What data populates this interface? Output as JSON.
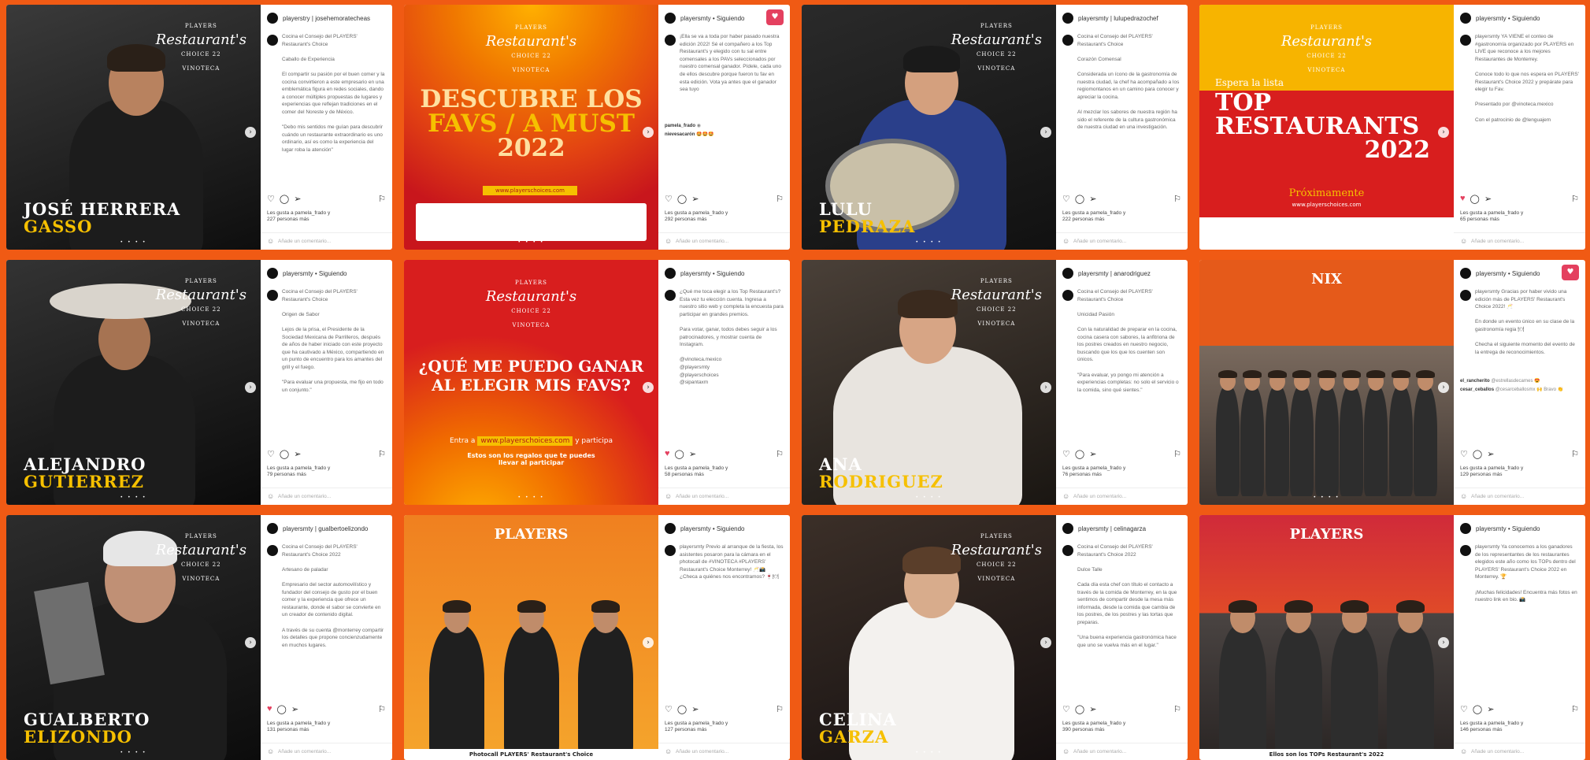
{
  "posts": [
    {
      "handle": "playerstry | josehemoratecheas",
      "author": "playersmty",
      "caption": "Cocina el Consejo del PLAYERS' Restaurant's Choice\n\nCaballo de Experiencia\n\nEl compartir su pasión por el buen comer y la cocina convirtieron a este empresario en una emblemática figura en redes sociales, dando a conocer múltiples propuestas de lugares y experiencias que reflejan tradiciones en el comer del Noreste y de México.\n\n\"Debo mis sentidos me guían para descubrir cuándo un restaurante extraordinario es uno ordinario, así es como la experiencia del lugar roba la atención\"",
      "comments": [],
      "likes_line1": "Les gusta a pamela_frado y",
      "likes_line2": "227 personas más",
      "add_comment": "Añade un comentario...",
      "name_line1": "JOSÉ HERRERA",
      "name_line2": "GASSO"
    },
    {
      "handle": "playersmty • Siguiendo",
      "author": "playersmty",
      "caption": "¡Ella se va a toda por haber pasado nuestra edición 2022! Sé el compañero a los Top Restaurant's y elegido con tu sal entre comensales a los PAVs seleccionados por nuestro comensal ganador. Pídele, cada uno de ellos descubre porque fueron tu fav en esta edición. Vota ya antes que el ganador sea tuyo",
      "comments": [
        {
          "user": "pamela_frado",
          "text": "◉"
        },
        {
          "user": "nievesacarón",
          "text": "🤩🤩🤩"
        }
      ],
      "likes_line1": "Les gusta a pamela_frado y",
      "likes_line2": "292 personas más",
      "add_comment": "Añade un comentario...",
      "title_line1": "DESCUBRE LOS",
      "title_line2": "FAVS / A MUST",
      "title_line3": "2022",
      "url": "www.playerschoices.com"
    },
    {
      "handle": "playersmty | lulupedrazochef",
      "author": "playersmty",
      "caption": "Cocina el Consejo del PLAYERS' Restaurant's Choice\n\nCorazón Comensal\n\nConsiderada un ícono de la gastronomía de nuestra ciudad, la chef ha acompañado a los regiomontanos en un camino para conocer y apreciar la cocina.\n\nAl mezclar los sabores de nuestra región ha sido el referente de la cultura gastronómica de nuestra ciudad en una investigación.",
      "comments": [],
      "likes_line1": "Les gusta a pamela_frado y",
      "likes_line2": "222 personas más",
      "add_comment": "Añade un comentario...",
      "name_line1": "LULU",
      "name_line2": "PEDRAZA"
    },
    {
      "handle": "playersmty • Siguiendo",
      "author": "playersmty",
      "caption": "playersmty YA VIENE el conteo de #gastronomía organizado por PLAYERS en LIVE que reconoce a los mejores Restaurantes de Monterrey.\n\nConoce todo lo que nos espera en PLAYERS' Restaurant's Choice 2022 y prepárate para elegir tu Fav.\n\nPresentado por @vinoteca.mexico\n\nCon el patrocinio de @lenguajem",
      "comments": [],
      "likes_line1": "Les gusta a pamela_frado y",
      "likes_line2": "65 personas más",
      "add_comment": "Añade un comentario...",
      "subtitle": "Espera la lista",
      "title_line1": "TOP",
      "title_line2": "RESTAURANTS",
      "title_line3": "2022",
      "footer": "Próximamente",
      "url": "www.playerschoices.com"
    },
    {
      "handle": "playersmty • Siguiendo",
      "author": "playersmty",
      "caption": "Cocina el Consejo del PLAYERS' Restaurant's Choice\n\nOrigen de Sabor\n\nLejos de la prisa, el Presidente de la Sociedad Mexicana de Parrilleros, después de años de haber iniciado con este proyecto que ha cautivado a México, compartiendo en un punto de encuentro para los amantes del grill y el fuego.\n\n\"Para evaluar una propuesta, me fijo en todo un conjunto.\"",
      "comments": [],
      "likes_line1": "Les gusta a pamela_frado y",
      "likes_line2": "79 personas más",
      "add_comment": "Añade un comentario...",
      "name_line1": "ALEJANDRO",
      "name_line2": "GUTIERREZ"
    },
    {
      "handle": "playersmty • Siguiendo",
      "author": "playersmty",
      "caption": "¿Qué me toca elegir a los Top Restaurant's? Esta vez tu elección cuenta. Ingresa a nuestro sitio web y completa la encuesta para participar en grandes premios.\n\nPara votar, ganar, todos debes seguir a los patrocinadores, y mostrar cuenta de Instagram.\n\n@vinoteca.mexico\n@playersmty\n@playerschoices\n@sipantaxm",
      "comments": [],
      "likes_line1": "Les gusta a pamela_frado y",
      "likes_line2": "58 personas más",
      "add_comment": "Añade un comentario...",
      "title_line1": "¿QUÉ ME PUEDO GANAR",
      "title_line2": "AL ELEGIR MIS FAVS?",
      "enter_text": "Entra a",
      "url": "www.playerschoices.com",
      "participa": "y participa",
      "prizes_line1": "Estos son los regalos que te puedes",
      "prizes_line2": "llevar al participar"
    },
    {
      "handle": "playersmty | anarodriguez",
      "author": "playersmty",
      "caption": "Cocina el Consejo del PLAYERS' Restaurant's Choice\n\nUnicidad Pasión\n\nCon la naturalidad de preparar en la cocina, cocina casera con sabores, la anfitriona de los postres creados en nuestro negocio, buscando que los que los cuenten son únicos.\n\n\"Para evaluar, yo pongo mi atención a experiencias completas: no solo el servicio o la comida, sino qué sientes.\"",
      "comments": [],
      "likes_line1": "Les gusta a pamela_frado y",
      "likes_line2": "76 personas más",
      "add_comment": "Añade un comentario...",
      "name_line1": "ANA",
      "name_line2": "RODRIGUEZ"
    },
    {
      "handle": "playersmty • Siguiendo",
      "author": "playersmty",
      "caption": "playersmty Gracias por haber vivido una edición más de PLAYERS' Restaurant's Choice 2022! 🥂\n\nEn donde un evento único en su clase de la gastronomía regia 🍽\n\nChecha el siguiente momento del evento de la entrega de reconocimientos.",
      "comments": [
        {
          "user": "el_rancherito",
          "text": "@estrellasdecarnes 😍"
        },
        {
          "user": "cesar_ceballos",
          "text": "@cesarceballosmx 🙌 Bravo 👏"
        }
      ],
      "likes_line1": "Les gusta a pamela_frado y",
      "likes_line2": "129 personas más",
      "add_comment": "Añade un comentario...",
      "banner": "NIX"
    },
    {
      "handle": "playersmty | gualbertoelizondo",
      "author": "playersmty",
      "caption": "Cocina el Consejo del PLAYERS' Restaurant's Choice 2022\n\nArtesano de paladar\n\nEmpresario del sector automovilístico y fundador del consejo de gusto por el buen comer y la experiencia que ofrece un restaurante, donde el sabor se convierte en un creador de contenido digital.\n\nA través de su cuenta @monterrey compartir los detalles que propone concienzudamente en muchos lugares.",
      "comments": [],
      "likes_line1": "Les gusta a pamela_frado y",
      "likes_line2": "131 personas más",
      "add_comment": "Añade un comentario...",
      "name_line1": "GUALBERTO",
      "name_line2": "ELIZONDO"
    },
    {
      "handle": "playersmty • Siguiendo",
      "author": "playersmty",
      "caption": "playersmty Previo al arranque de la fiesta, los asistentes posaron para la cámara en el photocall de #VINOTECA #PLAYERS' Restaurant's Choice Monterrey! 🥂📸 ¿Checa a quiénes nos encontramos? 🍷🍽",
      "comments": [],
      "likes_line1": "Les gusta a pamela_frado y",
      "likes_line2": "127 personas más",
      "add_comment": "Añade un comentario...",
      "banner": "PLAYERS",
      "caption_footer": "Photocall PLAYERS' Restaurant's Choice"
    },
    {
      "handle": "playersmty | celinagarza",
      "author": "playersmty",
      "caption": "Cocina el Consejo del PLAYERS' Restaurant's Choice 2022\n\nDulce Talle\n\nCada día esta chef con título el contacto a través de la comida de Monterrey, en la que sentimos de compartir desde la mesa más informada, desde la comida que cambia de los postres, de los postres y las tortas que preparas.\n\n\"Una buena experiencia gastronómica hace que uno se vuelva más en el lugar.\"",
      "comments": [],
      "likes_line1": "Les gusta a pamela_frado y",
      "likes_line2": "390 personas más",
      "add_comment": "Añade un comentario...",
      "name_line1": "CELINA",
      "name_line2": "GARZA"
    },
    {
      "handle": "playersmty • Siguiendo",
      "author": "playersmty",
      "caption": "playersmty Ya conocemos a los ganadores de los representantes de los restaurantes elegidos este año como los TOPs dentro del PLAYERS' Restaurant's Choice 2022 en Monterrey. 🏆\n\n¡Muchas felicidades! Encuentra más fotos en nuestro link en bio. 📸",
      "comments": [],
      "likes_line1": "Les gusta a pamela_frado y",
      "likes_line2": "146 personas más",
      "add_comment": "Añade un comentario...",
      "banner": "PLAYERS",
      "caption_footer": "Ellos son los TOPs Restaurant's 2022"
    }
  ],
  "logo": {
    "script": "Restaurant's",
    "top": "PLAYERS",
    "choice": "CHOICE 22",
    "sponsor": "VINOTECA"
  },
  "icons": {
    "heart": "heart-icon",
    "comment": "comment-icon",
    "share": "share-icon",
    "save": "bookmark-icon",
    "next": "chevron-right-icon"
  },
  "colors": {
    "background": "#f05a14",
    "brand_yellow": "#f6c000",
    "brand_red": "#d81e1e"
  }
}
